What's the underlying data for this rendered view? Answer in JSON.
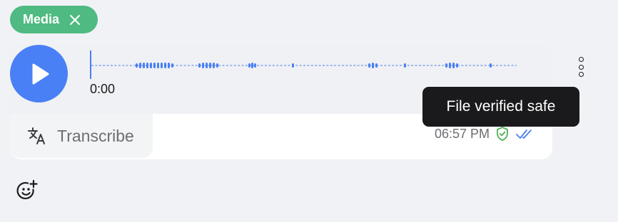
{
  "chip": {
    "label": "Media"
  },
  "player": {
    "current_time": "0:00",
    "progress": 0.0,
    "accent_color": "#4a80f5"
  },
  "transcribe": {
    "label": "Transcribe"
  },
  "meta": {
    "timestamp": "06:57 PM",
    "verified_color": "#4caf50",
    "read_color": "#4a80f5"
  },
  "tooltip": {
    "text": "File verified safe"
  },
  "colors": {
    "chip_bg": "#4fba82",
    "background": "#f1f2f5",
    "tooltip_bg": "#1a1a1c"
  }
}
